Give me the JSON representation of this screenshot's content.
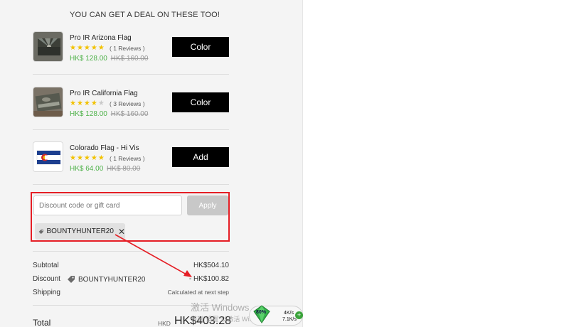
{
  "upsell": {
    "title": "YOU CAN GET A DEAL ON THESE TOO!",
    "products": [
      {
        "name": "Pro IR Arizona Flag",
        "rating": 5,
        "reviews": "( 1 Reviews )",
        "price": "HK$ 128.00",
        "old_price": "HK$ 160.00",
        "button": "Color"
      },
      {
        "name": "Pro IR California Flag",
        "rating": 4,
        "reviews": "( 3 Reviews )",
        "price": "HK$ 128.00",
        "old_price": "HK$ 160.00",
        "button": "Color"
      },
      {
        "name": "Colorado Flag - Hi Vis",
        "rating": 5,
        "reviews": "( 1 Reviews )",
        "price": "HK$ 64.00",
        "old_price": "HK$ 80.00",
        "button": "Add"
      }
    ]
  },
  "discount": {
    "placeholder": "Discount code or gift card",
    "apply_label": "Apply",
    "applied_code": "BOUNTYHUNTER20",
    "remove_symbol": "✕"
  },
  "summary": {
    "subtotal_label": "Subtotal",
    "subtotal_value": "HK$504.10",
    "discount_label": "Discount",
    "discount_code": "BOUNTYHUNTER20",
    "discount_value": "- HK$100.82",
    "shipping_label": "Shipping",
    "shipping_value": "Calculated at next step",
    "total_label": "Total",
    "total_currency": "HKD",
    "total_value": "HK$403.28"
  },
  "annotation": {
    "color": "#e51e25"
  },
  "overlay": {
    "watermark_line1": "激活 Windows",
    "watermark_line2": "转到\"设置\"以激活 Windows。",
    "widget_percent": "80%",
    "widget_up": "4K/s",
    "widget_down": "7.1K/s",
    "widget_plus": "+"
  },
  "colors": {
    "price_green": "#4fb24a",
    "star_gold": "#f2c200",
    "button_black": "#000000"
  }
}
